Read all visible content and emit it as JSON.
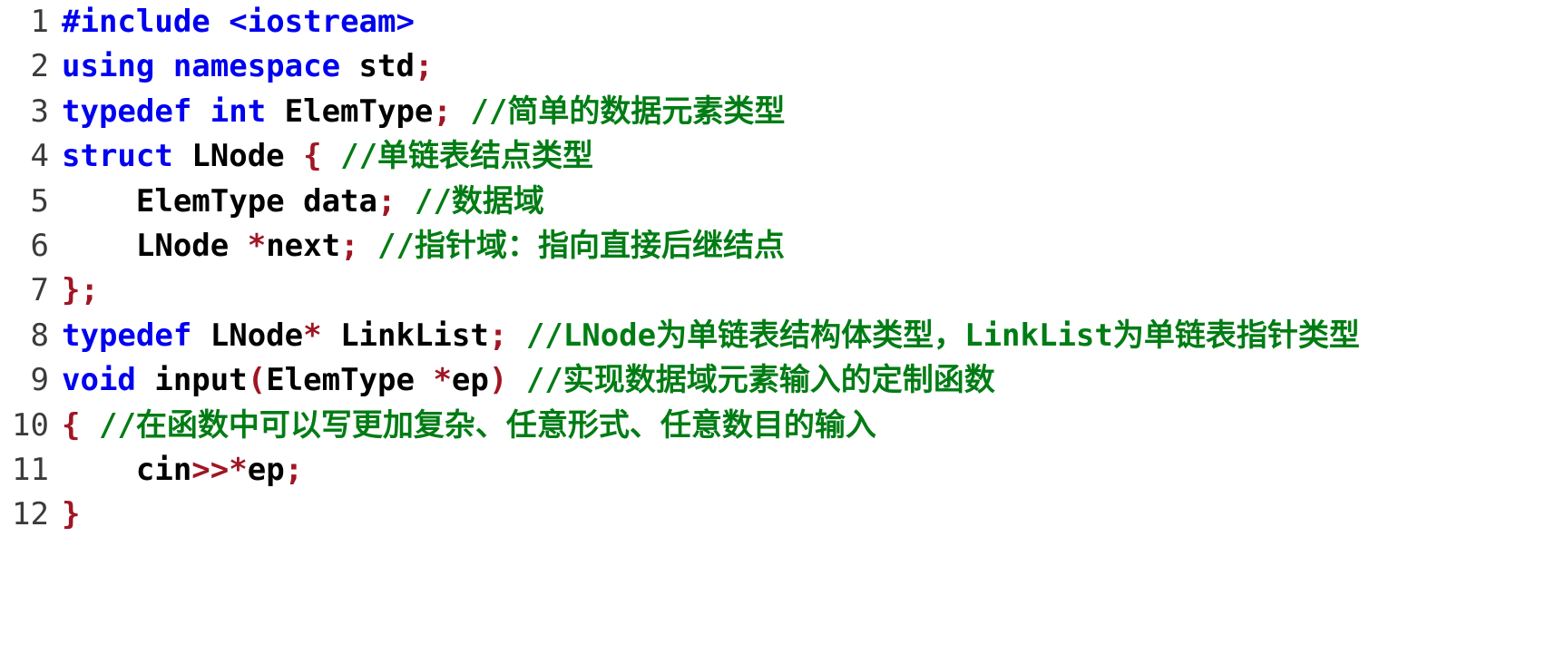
{
  "editor": {
    "language": "C++",
    "background_color": "#ffffff",
    "font_weight": "bold",
    "colors": {
      "line_number": "#3b3b3b",
      "keyword": "#0000f0",
      "identifier": "#000000",
      "punctuation": "#a01624",
      "comment": "#007c14"
    },
    "lines": [
      {
        "number": "1",
        "tokens": [
          {
            "type": "kw",
            "text": "#include"
          },
          {
            "type": "ident",
            "text": " "
          },
          {
            "type": "kw",
            "text": "<iostream>"
          }
        ]
      },
      {
        "number": "2",
        "tokens": [
          {
            "type": "kw",
            "text": "using namespace"
          },
          {
            "type": "ident",
            "text": " std"
          },
          {
            "type": "punct",
            "text": ";"
          }
        ]
      },
      {
        "number": "3",
        "tokens": [
          {
            "type": "kw",
            "text": "typedef int"
          },
          {
            "type": "ident",
            "text": " ElemType"
          },
          {
            "type": "punct",
            "text": ";"
          },
          {
            "type": "ident",
            "text": " "
          },
          {
            "type": "comment",
            "text": "//简单的数据元素类型"
          }
        ]
      },
      {
        "number": "4",
        "tokens": [
          {
            "type": "kw",
            "text": "struct"
          },
          {
            "type": "ident",
            "text": " LNode "
          },
          {
            "type": "punct",
            "text": "{"
          },
          {
            "type": "ident",
            "text": " "
          },
          {
            "type": "comment",
            "text": "//单链表结点类型"
          }
        ]
      },
      {
        "number": "5",
        "tokens": [
          {
            "type": "ident",
            "text": "    ElemType data"
          },
          {
            "type": "punct",
            "text": ";"
          },
          {
            "type": "ident",
            "text": " "
          },
          {
            "type": "comment",
            "text": "//数据域"
          }
        ]
      },
      {
        "number": "6",
        "tokens": [
          {
            "type": "ident",
            "text": "    LNode "
          },
          {
            "type": "punct",
            "text": "*"
          },
          {
            "type": "ident",
            "text": "next"
          },
          {
            "type": "punct",
            "text": ";"
          },
          {
            "type": "ident",
            "text": " "
          },
          {
            "type": "comment",
            "text": "//指针域：指向直接后继结点"
          }
        ]
      },
      {
        "number": "7",
        "tokens": [
          {
            "type": "punct",
            "text": "};"
          }
        ]
      },
      {
        "number": "8",
        "tokens": [
          {
            "type": "kw",
            "text": "typedef"
          },
          {
            "type": "ident",
            "text": " LNode"
          },
          {
            "type": "punct",
            "text": "*"
          },
          {
            "type": "ident",
            "text": " LinkList"
          },
          {
            "type": "punct",
            "text": ";"
          },
          {
            "type": "ident",
            "text": " "
          },
          {
            "type": "comment",
            "text": "//LNode为单链表结构体类型，LinkList为单链表指针类型"
          }
        ]
      },
      {
        "number": "9",
        "tokens": [
          {
            "type": "kw",
            "text": "void"
          },
          {
            "type": "ident",
            "text": " input"
          },
          {
            "type": "punct",
            "text": "("
          },
          {
            "type": "ident",
            "text": "ElemType "
          },
          {
            "type": "punct",
            "text": "*"
          },
          {
            "type": "ident",
            "text": "ep"
          },
          {
            "type": "punct",
            "text": ")"
          },
          {
            "type": "ident",
            "text": " "
          },
          {
            "type": "comment",
            "text": "//实现数据域元素输入的定制函数"
          }
        ]
      },
      {
        "number": "10",
        "tokens": [
          {
            "type": "punct",
            "text": "{"
          },
          {
            "type": "ident",
            "text": " "
          },
          {
            "type": "comment",
            "text": "//在函数中可以写更加复杂、任意形式、任意数目的输入"
          }
        ]
      },
      {
        "number": "11",
        "tokens": [
          {
            "type": "ident",
            "text": "    cin"
          },
          {
            "type": "punct",
            "text": ">>*"
          },
          {
            "type": "ident",
            "text": "ep"
          },
          {
            "type": "punct",
            "text": ";"
          }
        ]
      },
      {
        "number": "12",
        "tokens": [
          {
            "type": "punct",
            "text": "}"
          }
        ]
      }
    ]
  }
}
